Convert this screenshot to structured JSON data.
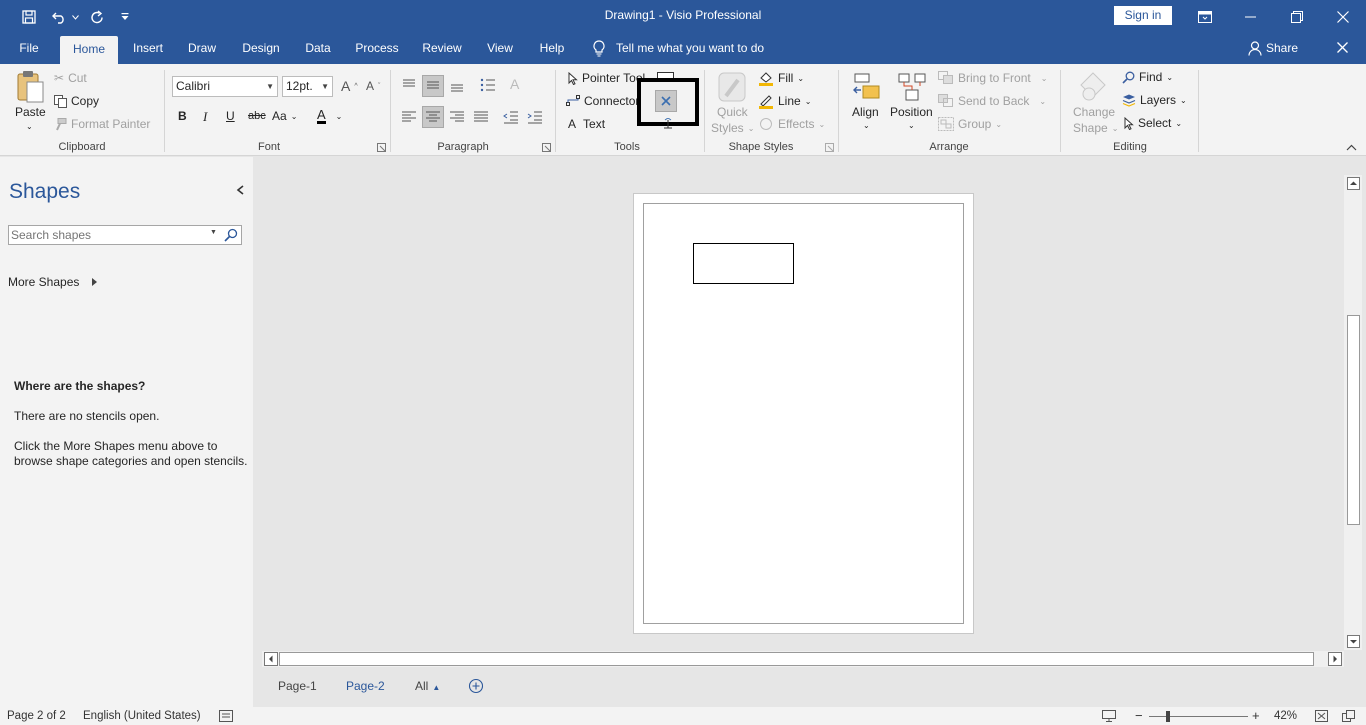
{
  "titlebar": {
    "doc_title": "Drawing1  -  Visio Professional",
    "sign_in": "Sign in",
    "icons": [
      "save-icon",
      "undo-icon",
      "redo-icon",
      "customize-qat-icon",
      "ribbon-display-icon",
      "minimize-icon",
      "restore-icon",
      "close-icon"
    ]
  },
  "tabs": {
    "file": "File",
    "home": "Home",
    "insert": "Insert",
    "draw": "Draw",
    "design": "Design",
    "data": "Data",
    "process": "Process",
    "review": "Review",
    "view": "View",
    "help": "Help",
    "tell_me": "Tell me what you want to do",
    "share": "Share"
  },
  "ribbon": {
    "clipboard": {
      "label": "Clipboard",
      "paste": "Paste",
      "cut": "Cut",
      "copy": "Copy",
      "format_painter": "Format Painter"
    },
    "font": {
      "label": "Font",
      "family": "Calibri",
      "size": "12pt."
    },
    "paragraph": {
      "label": "Paragraph"
    },
    "tools": {
      "label": "Tools",
      "pointer": "Pointer Tool",
      "connector": "Connector",
      "text": "Text"
    },
    "shape_styles": {
      "label": "Shape Styles",
      "quick_styles_1": "Quick",
      "quick_styles_2": "Styles",
      "fill": "Fill",
      "line": "Line",
      "effects": "Effects"
    },
    "arrange": {
      "label": "Arrange",
      "align": "Align",
      "position": "Position",
      "bring_to_front": "Bring to Front",
      "send_to_back": "Send to Back",
      "group": "Group"
    },
    "editing": {
      "label": "Editing",
      "change_shape_1": "Change",
      "change_shape_2": "Shape",
      "find": "Find",
      "layers": "Layers",
      "select": "Select"
    }
  },
  "shapes_pane": {
    "title": "Shapes",
    "search_placeholder": "Search shapes",
    "more_shapes": "More Shapes",
    "heading": "Where are the shapes?",
    "line1": "There are no stencils open.",
    "line2a": "Click the More Shapes menu above to",
    "line2b": "browse shape categories and open stencils."
  },
  "page_tabs": {
    "page1": "Page-1",
    "page2": "Page-2",
    "all": "All"
  },
  "status": {
    "page": "Page 2 of 2",
    "language": "English (United States)",
    "zoom": "42%"
  },
  "colors": {
    "accent": "#2b579a",
    "ribbon": "#f3f3f3",
    "canvas": "#e6e6e6",
    "highlight_box": "#000000"
  }
}
